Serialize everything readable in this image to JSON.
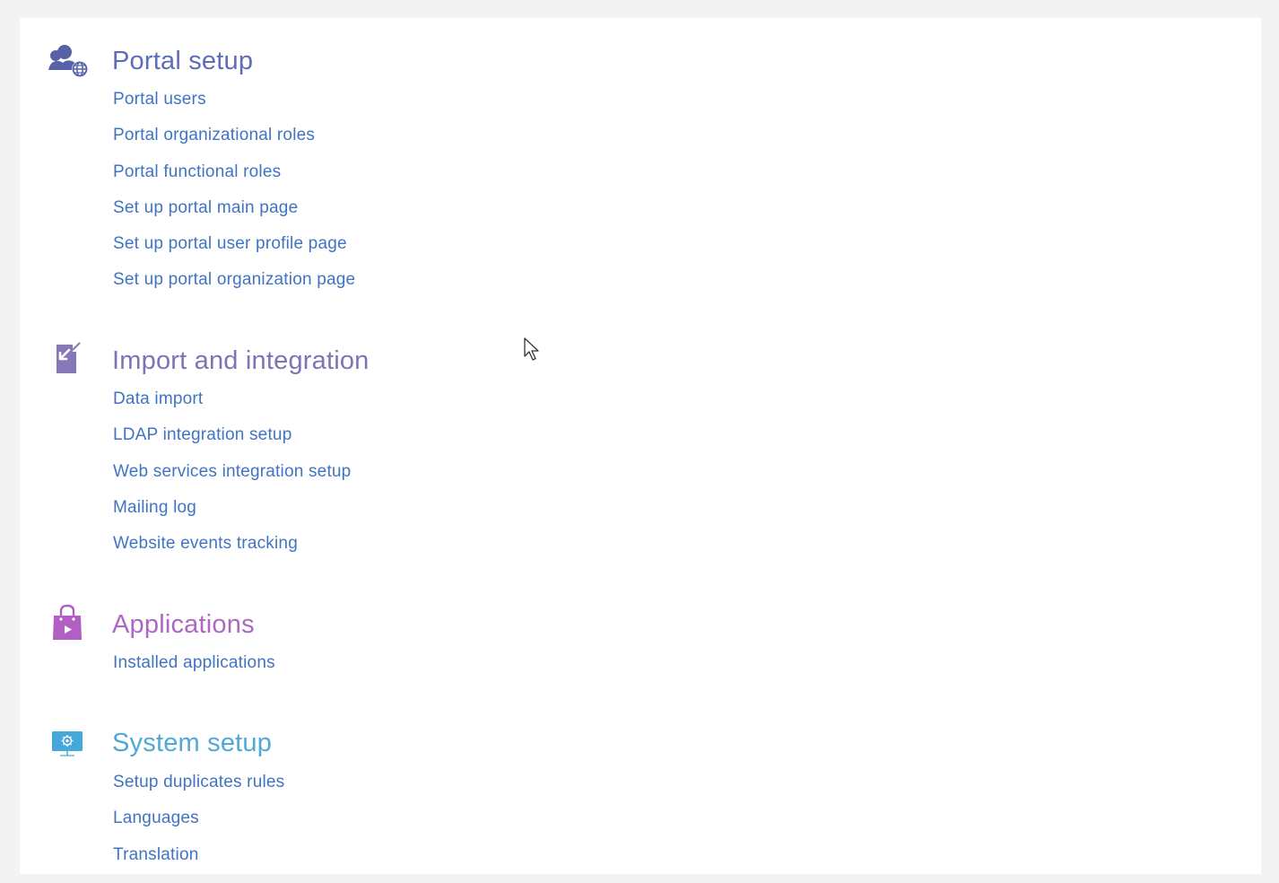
{
  "sections": [
    {
      "title": "Portal setup",
      "title_color": "#5d6db8",
      "icon": "portal-users-globe-icon",
      "icon_color": "#5563a6",
      "links": [
        "Portal users",
        "Portal organizational roles",
        "Portal functional roles",
        "Set up portal main page",
        "Set up portal user profile page",
        "Set up portal organization page"
      ]
    },
    {
      "title": "Import and integration",
      "title_color": "#7f73b5",
      "icon": "import-document-icon",
      "icon_color": "#8577b8",
      "links": [
        "Data import",
        "LDAP integration setup",
        "Web services integration setup",
        "Mailing log",
        "Website events tracking"
      ]
    },
    {
      "title": "Applications",
      "title_color": "#ad69c2",
      "icon": "shopping-bag-play-icon",
      "icon_color": "#b25fc4",
      "links": [
        "Installed applications"
      ]
    },
    {
      "title": "System setup",
      "title_color": "#4fa9d6",
      "icon": "monitor-gear-icon",
      "icon_color": "#45a8d8",
      "links": [
        "Setup duplicates rules",
        "Languages",
        "Translation"
      ]
    }
  ],
  "link_color": "#3f74c4"
}
